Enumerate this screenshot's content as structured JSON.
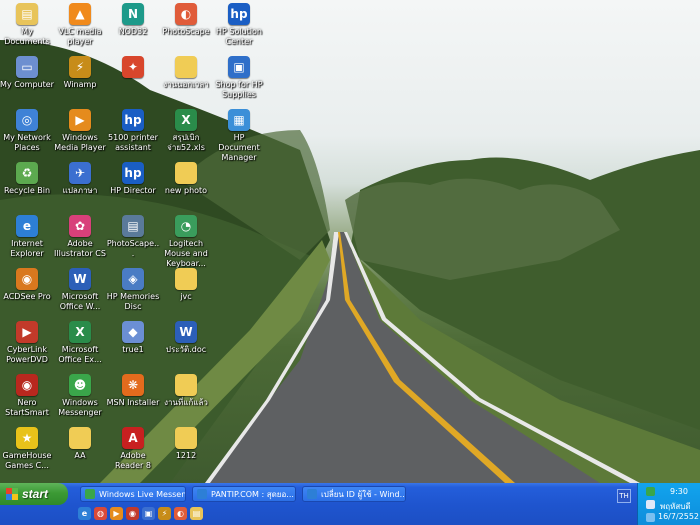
{
  "desktop": {
    "icons": [
      {
        "label": "My Documents",
        "icon": "folder-documents-icon",
        "color": "#e8c45a",
        "glyph": "▤"
      },
      {
        "label": "VLC media player",
        "icon": "vlc-cone-icon",
        "color": "#f08a1c",
        "glyph": "▲"
      },
      {
        "label": "NOD32",
        "icon": "nod32-icon",
        "color": "#1d9a8a",
        "glyph": "N"
      },
      {
        "label": "PhotoScape",
        "icon": "photoscape-icon",
        "color": "#e05c3a",
        "glyph": "◐"
      },
      {
        "label": "HP Solution Center",
        "icon": "hp-solution-icon",
        "color": "#1a5ec4",
        "glyph": "hp"
      },
      {
        "label": "My Computer",
        "icon": "computer-icon",
        "color": "#6d8fd0",
        "glyph": "▭"
      },
      {
        "label": "Winamp",
        "icon": "winamp-icon",
        "color": "#c78c19",
        "glyph": "⚡"
      },
      {
        "label": "",
        "icon": "app-icon",
        "color": "#d8462c",
        "glyph": "✦"
      },
      {
        "label": "งานนอกเวลา",
        "icon": "folder-icon",
        "color": "#f0cc55",
        "glyph": ""
      },
      {
        "label": "Shop for HP Supplies",
        "icon": "hp-shop-icon",
        "color": "#2f6fc9",
        "glyph": "▣"
      },
      {
        "label": "My Network Places",
        "icon": "network-icon",
        "color": "#3f82d6",
        "glyph": "◎"
      },
      {
        "label": "Windows Media Player",
        "icon": "media-player-icon",
        "color": "#e58b1d",
        "glyph": "▶"
      },
      {
        "label": "5100 printer assistant",
        "icon": "hp-printer-icon",
        "color": "#1a5ec4",
        "glyph": "hp"
      },
      {
        "label": "สรุปเบิกจ่าย52.xls",
        "icon": "excel-file-icon",
        "color": "#2a8c4a",
        "glyph": "X"
      },
      {
        "label": "HP Document Manager",
        "icon": "hp-document-icon",
        "color": "#3b8fd8",
        "glyph": "▦"
      },
      {
        "label": "Recycle Bin",
        "icon": "recycle-bin-icon",
        "color": "#5ca94f",
        "glyph": "♻"
      },
      {
        "label": "แปลภาษา",
        "icon": "translate-icon",
        "color": "#3b6fd0",
        "glyph": "✈"
      },
      {
        "label": "HP Director",
        "icon": "hp-director-icon",
        "color": "#1a5ec4",
        "glyph": "hp"
      },
      {
        "label": "new photo",
        "icon": "folder-icon",
        "color": "#f0cc55",
        "glyph": ""
      },
      {
        "label": "",
        "icon": "",
        "color": "",
        "glyph": ""
      },
      {
        "label": "Internet Explorer",
        "icon": "internet-explorer-icon",
        "color": "#2d7fd6",
        "glyph": "e"
      },
      {
        "label": "Adobe Illustrator CS",
        "icon": "illustrator-flower-icon",
        "color": "#d8407a",
        "glyph": "✿"
      },
      {
        "label": "PhotoScape...",
        "icon": "photoscape-shortcut-icon",
        "color": "#5a7a9a",
        "glyph": "▤"
      },
      {
        "label": "Logitech Mouse and Keyboar...",
        "icon": "logitech-icon",
        "color": "#3a9d5c",
        "glyph": "◔"
      },
      {
        "label": "",
        "icon": "",
        "color": "",
        "glyph": ""
      },
      {
        "label": "ACDSee Pro",
        "icon": "acdsee-icon",
        "color": "#d9781e",
        "glyph": "◉"
      },
      {
        "label": "Microsoft Office W...",
        "icon": "word-icon",
        "color": "#2c5fb8",
        "glyph": "W"
      },
      {
        "label": "HP Memories Disc",
        "icon": "hp-memories-icon",
        "color": "#4a7cc4",
        "glyph": "◈"
      },
      {
        "label": "jvc",
        "icon": "folder-icon",
        "color": "#f0cc55",
        "glyph": ""
      },
      {
        "label": "",
        "icon": "",
        "color": "",
        "glyph": ""
      },
      {
        "label": "CyberLink PowerDVD",
        "icon": "powerdvd-icon",
        "color": "#c23a2a",
        "glyph": "▶"
      },
      {
        "label": "Microsoft Office Ex...",
        "icon": "excel-icon",
        "color": "#2a8c4a",
        "glyph": "X"
      },
      {
        "label": "true1",
        "icon": "true-app-icon",
        "color": "#6b8fd4",
        "glyph": "◆"
      },
      {
        "label": "ประวัติ.doc",
        "icon": "word-doc-icon",
        "color": "#2c5fb8",
        "glyph": "W"
      },
      {
        "label": "",
        "icon": "",
        "color": "",
        "glyph": ""
      },
      {
        "label": "Nero StartSmart",
        "icon": "nero-icon",
        "color": "#b8281e",
        "glyph": "◉"
      },
      {
        "label": "Windows Messenger",
        "icon": "messenger-icon",
        "color": "#3aa64a",
        "glyph": "☻"
      },
      {
        "label": "MSN Installer",
        "icon": "msn-butterfly-icon",
        "color": "#e36b1d",
        "glyph": "❋"
      },
      {
        "label": "งานที่แก้แล้ว",
        "icon": "folder-icon",
        "color": "#f0cc55",
        "glyph": ""
      },
      {
        "label": "",
        "icon": "",
        "color": "",
        "glyph": ""
      },
      {
        "label": "GameHouse Games C...",
        "icon": "gamehouse-star-icon",
        "color": "#e8c21a",
        "glyph": "★"
      },
      {
        "label": "AA",
        "icon": "folder-icon",
        "color": "#f0cc55",
        "glyph": ""
      },
      {
        "label": "Adobe Reader 8",
        "icon": "adobe-reader-icon",
        "color": "#c82020",
        "glyph": "A"
      },
      {
        "label": "1212",
        "icon": "folder-icon",
        "color": "#f0cc55",
        "glyph": ""
      },
      {
        "label": "",
        "icon": "",
        "color": "",
        "glyph": ""
      }
    ]
  },
  "taskbar": {
    "start_label": "start",
    "tasks": [
      {
        "label": "Windows Live Messen...",
        "icon": "messenger-task-icon",
        "color": "#3aa64a"
      },
      {
        "label": "PANTIP.COM : สุดยอ...",
        "icon": "ie-task-icon",
        "color": "#2d7fd6"
      },
      {
        "label": "เปลี่ยน ID ผู้ใช้ - Wind...",
        "icon": "ie-task-icon",
        "color": "#2d7fd6"
      }
    ],
    "quick_launch": [
      {
        "icon": "ie-icon",
        "color": "#2d7fd6",
        "glyph": "e"
      },
      {
        "icon": "chrome-icon",
        "color": "#d94a38",
        "glyph": "◍"
      },
      {
        "icon": "media-icon",
        "color": "#e58b1d",
        "glyph": "▶"
      },
      {
        "icon": "app-red-icon",
        "color": "#c23a2a",
        "glyph": "◉"
      },
      {
        "icon": "window-icon",
        "color": "#3b6fd0",
        "glyph": "▣"
      },
      {
        "icon": "winamp-icon",
        "color": "#c78c19",
        "glyph": "⚡"
      },
      {
        "icon": "photoscape-icon",
        "color": "#e05c3a",
        "glyph": "◐"
      },
      {
        "icon": "folder-icon",
        "color": "#e8c45a",
        "glyph": "▤"
      }
    ],
    "language": "TH",
    "clock": "9:30",
    "day": "พฤหัสบดี",
    "date": "16/7/2552"
  }
}
